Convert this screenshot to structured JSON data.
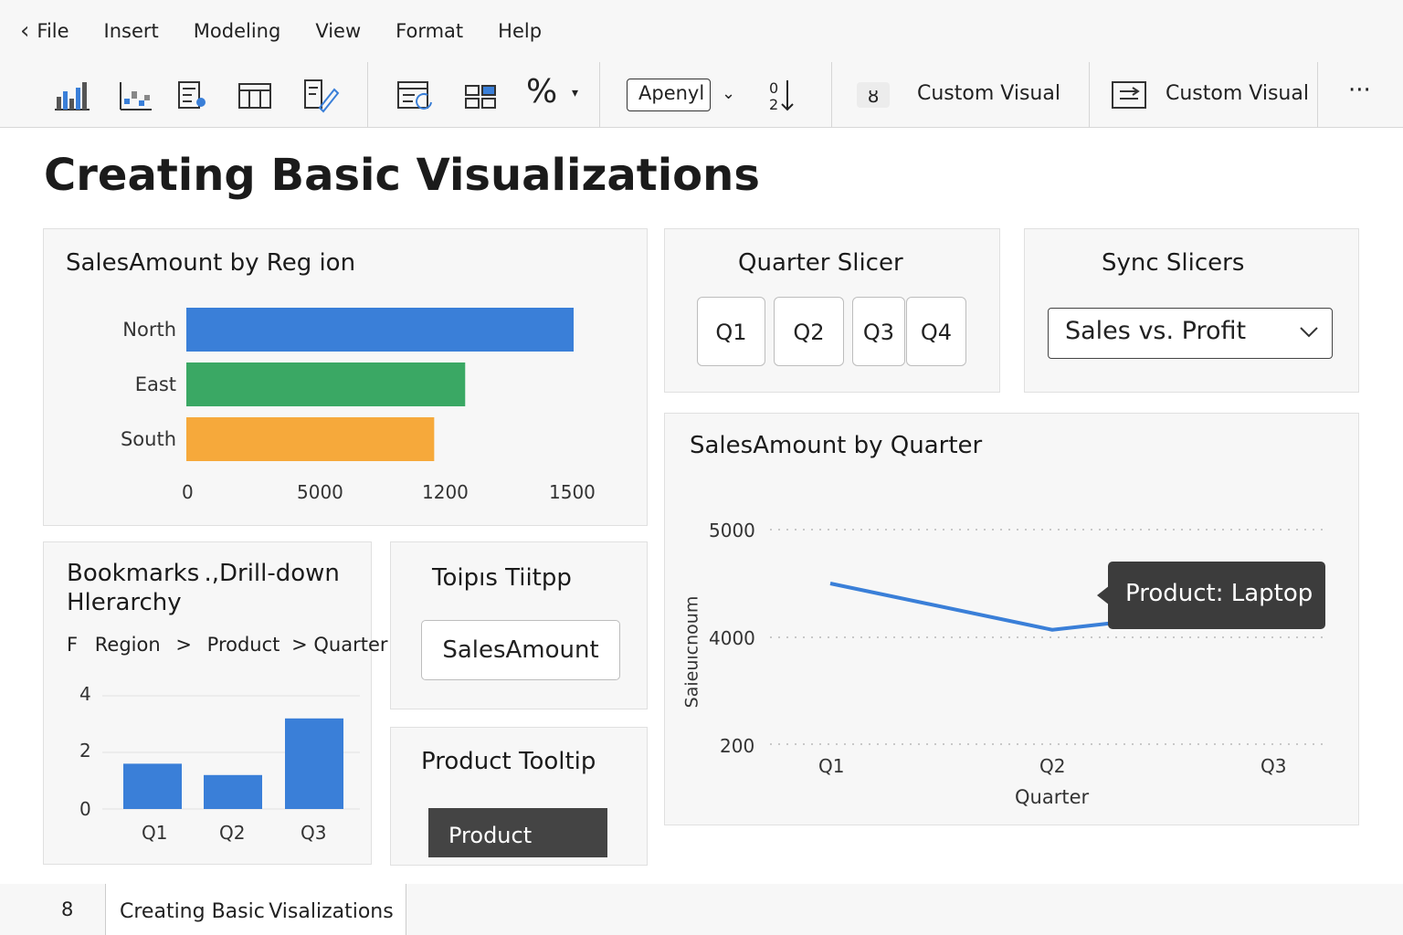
{
  "menu": {
    "back_icon": "chevron-left-icon",
    "items": [
      "File",
      "Insert",
      "Modeling",
      "View",
      "Format",
      "Help"
    ]
  },
  "toolbar": {
    "font_name": "Apenyl",
    "sort_icon_text": "0\n2",
    "custom_visual_1": "Custom Visual",
    "custom_visual_2": "Custom Visual",
    "more": "···"
  },
  "page": {
    "title": "Creating Basic Visualizations"
  },
  "region_chart": {
    "title": "SalesAmount by Reg ion",
    "chart_data": {
      "type": "bar",
      "orientation": "horizontal",
      "categories": [
        "North",
        "East",
        "South"
      ],
      "values": [
        1500,
        1080,
        960
      ],
      "xtick_labels": [
        "0",
        "5000",
        "1200",
        "1500"
      ],
      "colors": [
        "#3a7fd8",
        "#3aa864",
        "#f6a93b"
      ]
    }
  },
  "quarter_slicer": {
    "title": "Quarter Slicer",
    "buttons": [
      "Q1",
      "Q2",
      "Q3",
      "Q4"
    ]
  },
  "sync_slicers": {
    "title": "Sync Slicers",
    "selected": "Sales vs. Profit"
  },
  "bookmarks": {
    "title_line1": "Bookmarks .,Drill-down",
    "title_line2": "Hlerarchy",
    "breadcrumb": {
      "icon": "F",
      "a": "Region",
      "sep1": ">",
      "b": "Product",
      "sep2": ">",
      "c": "Quarter"
    },
    "chart_data": {
      "type": "bar",
      "categories": [
        "Q1",
        "Q2",
        "Q3"
      ],
      "values": [
        1.6,
        1.2,
        3.2
      ],
      "ylim": [
        0,
        4
      ],
      "yticks": [
        "0",
        "2",
        "4"
      ],
      "color": "#3a7fd8"
    }
  },
  "tooltip_panel": {
    "title": "Toiрıs  Tiitpp",
    "field": "SalesAmount"
  },
  "product_tooltip": {
    "title": "Product Tooltip",
    "chip": "Product"
  },
  "quarter_chart": {
    "title": "SalesAmount by Quarter",
    "tooltip": "Product: Laptop",
    "chart_data": {
      "type": "line",
      "x": [
        "Q1",
        "Q2",
        "Q3"
      ],
      "y": [
        4500,
        4070,
        4300
      ],
      "ytick_labels": [
        "200",
        "4000",
        "5000"
      ],
      "ylabel": "Saieuıcnoum",
      "xlabel": "Quarter",
      "grid": "dotted",
      "color": "#3a7fd8"
    }
  },
  "status": {
    "page_number": "8",
    "tab": "Creating Basic Visalizations"
  }
}
